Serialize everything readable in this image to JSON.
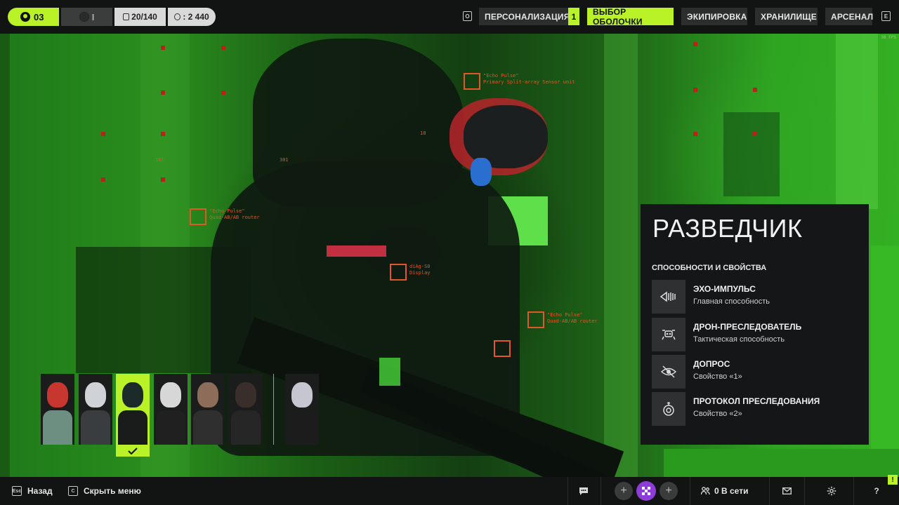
{
  "topbar": {
    "level": "03",
    "rank": "I",
    "cells": "20/140",
    "coins": ": 2 440",
    "personalization_key": "O",
    "tabs": [
      {
        "label": "ПЕРСОНАЛИЗАЦИЯ",
        "badge": "1",
        "active": false
      },
      {
        "label": "ВЫБОР ОБОЛОЧКИ",
        "active": true
      },
      {
        "label": "ЭКИПИРОВКА",
        "active": false
      },
      {
        "label": "ХРАНИЛИЩЕ",
        "active": false
      },
      {
        "label": "АРСЕНАЛ",
        "active": false
      }
    ],
    "next_key": "E",
    "fps": "38 FPS"
  },
  "scene": {
    "hud_labels": [
      "\"Echo Pulse\"\nPrimary Split-array Sensor unit",
      "\"Echo Pulse\"\nQuad-AB/AB router",
      "diAg-S0\nDisplay",
      "\"Echo Pulse\"\nQuad-AB/AB router",
      "18",
      "101",
      "301"
    ]
  },
  "class_panel": {
    "title": "РАЗВЕДЧИК",
    "abilities_heading": "СПОСОБНОСТИ И СВОЙСТВА",
    "abilities": [
      {
        "name": "ЭХО-ИМПУЛЬС",
        "type": "Главная способность",
        "icon": "sonar-pulse-icon"
      },
      {
        "name": "ДРОН-ПРЕСЛЕДОВАТЕЛЬ",
        "type": "Тактическая способность",
        "icon": "drone-icon"
      },
      {
        "name": "ДОПРОС",
        "type": "Свойство «1»",
        "icon": "crossed-eye-icon"
      },
      {
        "name": "ПРОТОКОЛ ПРЕСЛЕДОВАНИЯ",
        "type": "Свойство «2»",
        "icon": "tracker-icon"
      }
    ]
  },
  "roster": {
    "characters": [
      {
        "name": "character-1",
        "selected": false,
        "colors": {
          "head": "#c7372f",
          "torso": "#6d8f82"
        }
      },
      {
        "name": "character-2",
        "selected": false,
        "colors": {
          "head": "#cfd2d6",
          "torso": "#3a3d3f"
        }
      },
      {
        "name": "character-3",
        "selected": true,
        "colors": {
          "head": "#1d2a2a",
          "torso": "#1a1c1c"
        }
      },
      {
        "name": "character-4",
        "selected": false,
        "colors": {
          "head": "#d7d7d7",
          "torso": "#202020"
        }
      },
      {
        "name": "character-5",
        "selected": false,
        "colors": {
          "head": "#8d6d5a",
          "torso": "#2f2f2f"
        }
      },
      {
        "name": "character-6",
        "selected": false,
        "colors": {
          "head": "#3a2e2a",
          "torso": "#262626"
        }
      },
      {
        "name": "character-7",
        "selected": false,
        "colors": {
          "head": "#c6c6d0",
          "torso": "#1c1c1c"
        }
      }
    ]
  },
  "bottombar": {
    "back_key": "Esc",
    "back_label": "Назад",
    "hide_key": "C",
    "hide_label": "Скрыть меню",
    "online_label": "0 В сети",
    "notification": "!"
  },
  "colors": {
    "accent": "#b8f227",
    "panel": "#141617",
    "hud_orange": "#e2562a"
  }
}
